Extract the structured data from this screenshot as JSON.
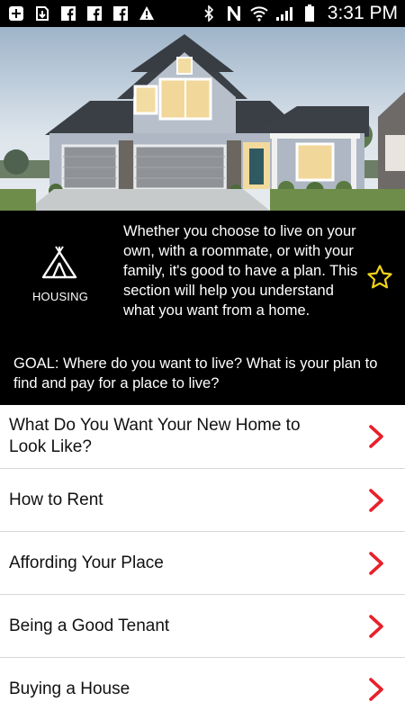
{
  "status_bar": {
    "time": "3:31 PM",
    "left_icons": [
      "add-icon",
      "download-icon",
      "facebook-icon",
      "facebook-icon",
      "facebook-icon",
      "warning-icon"
    ],
    "right_icons": [
      "bluetooth-icon",
      "n-icon",
      "wifi-icon",
      "signal-icon",
      "battery-icon"
    ]
  },
  "section": {
    "icon": "teepee-icon",
    "label": "HOUSING",
    "description": "Whether you choose to live on your own, with a roommate, or with your family, it's good to have a plan. This section will help you understand what you want from a home.",
    "goal": "GOAL: Where do you want to live?  What is your plan to find and pay for a place to live?",
    "favorite_icon": "star-outline-icon",
    "accent_color": "#f2d318"
  },
  "menu": {
    "chevron_color": "#e8202a",
    "items": [
      {
        "label": "What Do You Want Your New Home to Look Like?"
      },
      {
        "label": "How to Rent"
      },
      {
        "label": "Affording Your Place"
      },
      {
        "label": "Being a Good Tenant"
      },
      {
        "label": "Buying a House"
      }
    ]
  }
}
